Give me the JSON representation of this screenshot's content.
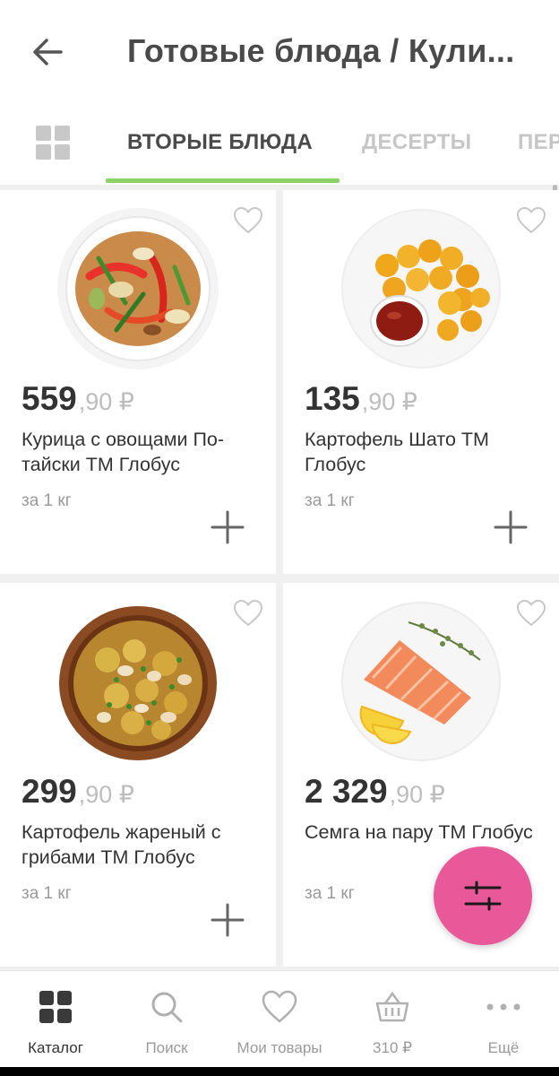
{
  "header": {
    "title": "Готовые блюда / Кули..."
  },
  "tabs": [
    {
      "label": "ВТОРЫЕ БЛЮДА",
      "active": true
    },
    {
      "label": "ДЕСЕРТЫ",
      "active": false
    },
    {
      "label": "ПЕР",
      "active": false
    }
  ],
  "products": [
    {
      "price_main": "559",
      "price_cents": ",90 ₽",
      "name": "Курица с овощами По-тайски ТМ Глобус",
      "unit": "за 1 кг",
      "image": "chicken-vegetables-image"
    },
    {
      "price_main": "135",
      "price_cents": ",90 ₽",
      "name": "Картофель Шато ТМ Глобус",
      "unit": "за 1 кг",
      "image": "potato-chateau-image"
    },
    {
      "price_main": "299",
      "price_cents": ",90 ₽",
      "name": "Картофель жареный с грибами ТМ Глобус",
      "unit": "за 1 кг",
      "image": "fried-potato-mushrooms-image"
    },
    {
      "price_main": "2 329",
      "price_cents": ",90 ₽",
      "name": "Семга на пару ТМ Глобус",
      "unit": "за 1 кг",
      "image": "steamed-salmon-image"
    }
  ],
  "bottom_nav": [
    {
      "label": "Каталог",
      "icon": "catalog-grid-icon",
      "active": true
    },
    {
      "label": "Поиск",
      "icon": "search-icon",
      "active": false
    },
    {
      "label": "Мои товары",
      "icon": "heart-icon",
      "active": false
    },
    {
      "label": "310 ₽",
      "icon": "basket-icon",
      "active": false
    },
    {
      "label": "Ещё",
      "icon": "more-dots-icon",
      "active": false
    }
  ],
  "colors": {
    "accent_green": "#8ed06a",
    "fab_pink": "#e9599a"
  }
}
